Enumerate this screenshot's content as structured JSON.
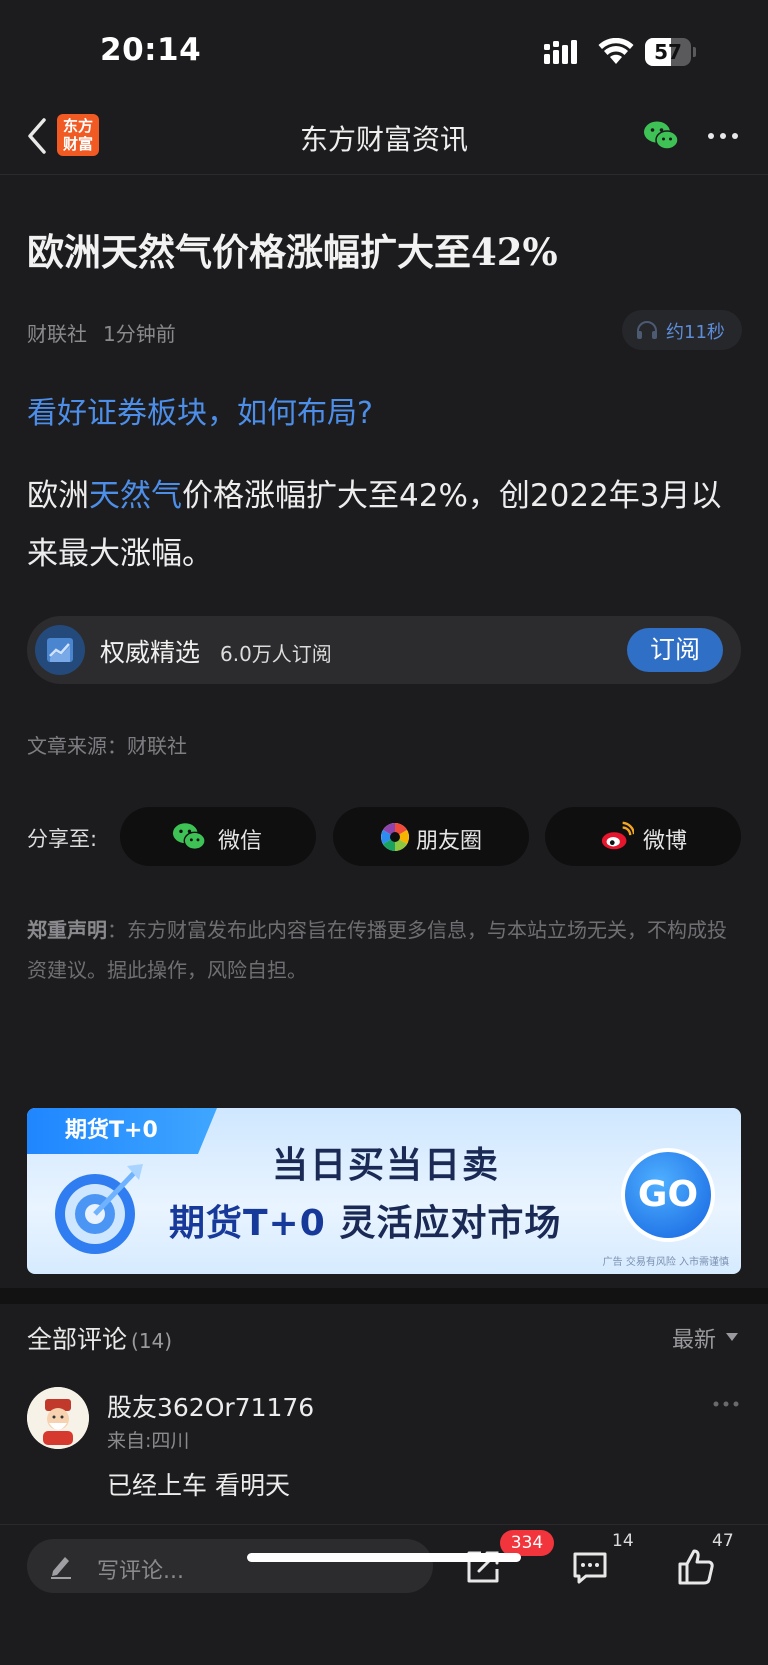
{
  "status_bar": {
    "time": "20:14",
    "battery": "57",
    "battery_level": 0.57
  },
  "nav": {
    "logo_line1": "东方",
    "logo_line2": "财富",
    "title": "东方财富资讯"
  },
  "article": {
    "title": "欧洲天然气价格涨幅扩大至42%",
    "source_name": "财联社",
    "time_ago": "1分钟前",
    "audio_duration": "约11秒",
    "promo_link": "看好证券板块，如何布局?",
    "body_prefix": "欧洲",
    "body_keyword": "天然气",
    "body_suffix": "价格涨幅扩大至42%，创2022年3月以来最大涨幅。"
  },
  "subscription": {
    "name": "权威精选",
    "count": "6.0万人订阅",
    "button": "订阅"
  },
  "article_source": "文章来源：财联社",
  "share": {
    "label": "分享至:",
    "wechat": "微信",
    "moments": "朋友圈",
    "weibo": "微博"
  },
  "disclaimer": {
    "heading": "郑重声明",
    "text": "：东方财富发布此内容旨在传播更多信息，与本站立场无关，不构成投资建议。据此操作，风险自担。"
  },
  "ad": {
    "tag": "期货T+0",
    "line1": "当日买当日卖",
    "line2_blue": "期货T+0",
    "line2_dark": "灵活应对市场",
    "button": "GO",
    "fine_print": "广告 交易有风险 入市需谨慎"
  },
  "comments": {
    "title": "全部评论",
    "count": "(14)",
    "sort": "最新",
    "items": [
      {
        "user": "股友362Or71176",
        "location": "来自:四川",
        "text": "已经上车 看明天"
      }
    ]
  },
  "bottom_bar": {
    "placeholder": "写评论...",
    "share_count": "334",
    "comment_count": "14",
    "like_count": "47"
  },
  "colors": {
    "accent_blue": "#4d8ee8",
    "badge_red": "#f2353c",
    "logo_orange": "#f25a23"
  }
}
